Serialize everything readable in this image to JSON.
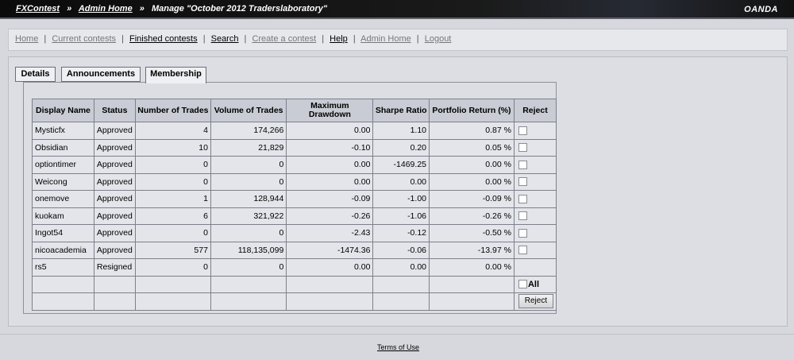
{
  "header": {
    "crumb_home": "FXContest",
    "crumb_admin": "Admin Home",
    "crumb_current": "Manage \"October 2012 Traderslaboratory\"",
    "separator": "»",
    "brand": "OANDA"
  },
  "nav": {
    "home": "Home",
    "current_contests": "Current contests",
    "finished_contests": "Finished contests",
    "search": "Search",
    "create_contest": "Create a contest",
    "help": "Help",
    "admin_home": "Admin Home",
    "logout": "Logout",
    "pipe": "|"
  },
  "tabs": {
    "details": "Details",
    "announcements": "Announcements",
    "membership": "Membership"
  },
  "table": {
    "headers": {
      "display_name": "Display Name",
      "status": "Status",
      "num_trades": "Number of Trades",
      "volume": "Volume of Trades",
      "max_drawdown": "Maximum Drawdown",
      "sharpe": "Sharpe Ratio",
      "portfolio_return": "Portfolio Return (%)",
      "reject": "Reject"
    },
    "rows": [
      {
        "name": "Mysticfx",
        "status": "Approved",
        "trades": "4",
        "volume": "174,266",
        "drawdown": "0.00",
        "sharpe": "1.10",
        "ret": "0.87 %"
      },
      {
        "name": "Obsidian",
        "status": "Approved",
        "trades": "10",
        "volume": "21,829",
        "drawdown": "-0.10",
        "sharpe": "0.20",
        "ret": "0.05 %"
      },
      {
        "name": "optiontimer",
        "status": "Approved",
        "trades": "0",
        "volume": "0",
        "drawdown": "0.00",
        "sharpe": "-1469.25",
        "ret": "0.00 %"
      },
      {
        "name": "Weicong",
        "status": "Approved",
        "trades": "0",
        "volume": "0",
        "drawdown": "0.00",
        "sharpe": "0.00",
        "ret": "0.00 %"
      },
      {
        "name": "onemove",
        "status": "Approved",
        "trades": "1",
        "volume": "128,944",
        "drawdown": "-0.09",
        "sharpe": "-1.00",
        "ret": "-0.09 %"
      },
      {
        "name": "kuokam",
        "status": "Approved",
        "trades": "6",
        "volume": "321,922",
        "drawdown": "-0.26",
        "sharpe": "-1.06",
        "ret": "-0.26 %"
      },
      {
        "name": "Ingot54",
        "status": "Approved",
        "trades": "0",
        "volume": "0",
        "drawdown": "-2.43",
        "sharpe": "-0.12",
        "ret": "-0.50 %"
      },
      {
        "name": "nicoacademia",
        "status": "Approved",
        "trades": "577",
        "volume": "118,135,099",
        "drawdown": "-1474.36",
        "sharpe": "-0.06",
        "ret": "-13.97 %"
      },
      {
        "name": "rs5",
        "status": "Resigned",
        "trades": "0",
        "volume": "0",
        "drawdown": "0.00",
        "sharpe": "0.00",
        "ret": "0.00 %"
      }
    ],
    "all_label": "All",
    "reject_button": "Reject"
  },
  "footer": {
    "terms": "Terms of Use"
  }
}
